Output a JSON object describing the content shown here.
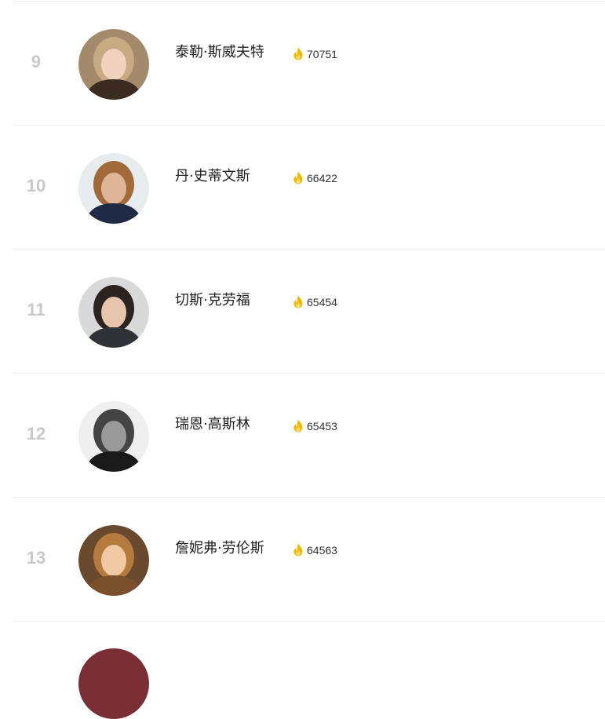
{
  "ranking": {
    "items": [
      {
        "rank": "9",
        "name": "泰勒·斯威夫特",
        "hot": "70751",
        "avatar_bg": "#a48a6c",
        "avatar_face": "#f1d2bd",
        "avatar_hair": "#c7a982",
        "avatar_top": "#3b2a21"
      },
      {
        "rank": "10",
        "name": "丹·史蒂文斯",
        "hot": "66422",
        "avatar_bg": "#e8ecef",
        "avatar_face": "#e0b497",
        "avatar_hair": "#a06a3a",
        "avatar_top": "#1f2a44"
      },
      {
        "rank": "11",
        "name": "切斯·克劳福",
        "hot": "65454",
        "avatar_bg": "#d9d9d9",
        "avatar_face": "#e7c4ad",
        "avatar_hair": "#2b2421",
        "avatar_top": "#2f3236"
      },
      {
        "rank": "12",
        "name": "瑞恩·高斯林",
        "hot": "65453",
        "avatar_bg": "#efefef",
        "avatar_face": "#9a9a9a",
        "avatar_hair": "#444444",
        "avatar_top": "#1a1a1a"
      },
      {
        "rank": "13",
        "name": "詹妮弗·劳伦斯",
        "hot": "64563",
        "avatar_bg": "#6a4a2e",
        "avatar_face": "#f0c8a4",
        "avatar_hair": "#b57a3e",
        "avatar_top": "#7a4f2b"
      }
    ],
    "partial_avatar_bg": "#7a2f36"
  },
  "colors": {
    "rank": "#c8c8c8",
    "flame": "#f5b800",
    "divider": "#eeeeee"
  },
  "icons": {
    "hot": "flame-icon"
  }
}
